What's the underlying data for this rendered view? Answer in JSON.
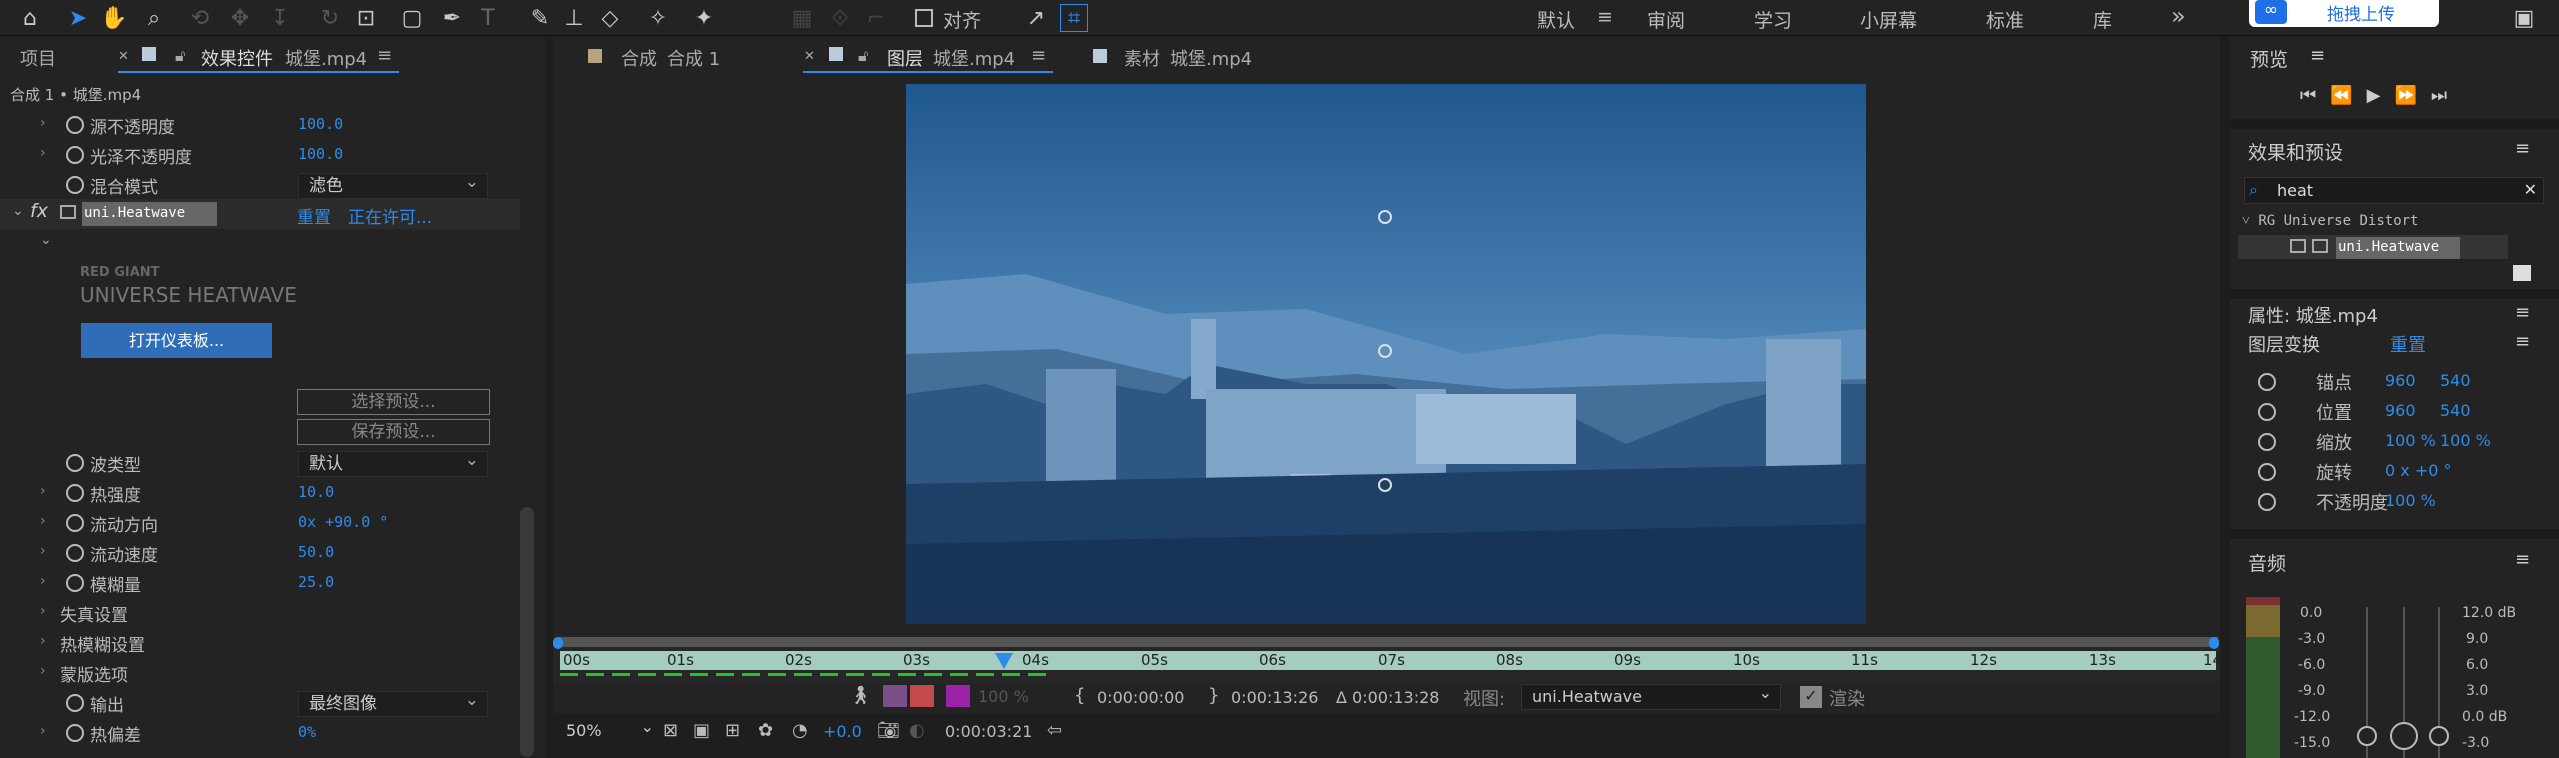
{
  "toolbar": {
    "align_label": "对齐",
    "workspaces": [
      "默认",
      "审阅",
      "学习",
      "小屏幕",
      "标准",
      "库"
    ],
    "upload_label": "拖拽上传",
    "more": "»",
    "menu_icon": "≡"
  },
  "left_panel": {
    "tabs": [
      "项目",
      "效果控件"
    ],
    "effect_file": "城堡.mp4",
    "breadcrumb": "合成 1 • 城堡.mp4",
    "rows_top": [
      {
        "label": "源不透明度",
        "value": "100.0"
      },
      {
        "label": "光泽不透明度",
        "value": "100.0"
      },
      {
        "label": "混合模式",
        "value": "滤色"
      }
    ],
    "fx_label": "fx",
    "effect_name": "uni.Heatwave",
    "reset": "重置",
    "licensing": "正在许可...",
    "brand_top": "RED GIANT",
    "brand_bottom": "UNIVERSE HEATWAVE",
    "open_dashboard": "打开仪表板...",
    "select_preset": "选择预设...",
    "save_preset": "保存预设...",
    "rows_bottom": [
      {
        "label": "波类型",
        "value": "默认",
        "dropdown": true
      },
      {
        "label": "热强度",
        "value": "10.0"
      },
      {
        "label": "流动方向",
        "value": "0x +90.0 °"
      },
      {
        "label": "流动速度",
        "value": "50.0"
      },
      {
        "label": "模糊量",
        "value": "25.0"
      }
    ],
    "groups": [
      "失真设置",
      "热模糊设置",
      "蒙版选项"
    ],
    "rows_end": [
      {
        "label": "输出",
        "value": "最终图像",
        "dropdown": true
      },
      {
        "label": "热偏差",
        "value": "0%"
      }
    ]
  },
  "viewer": {
    "tabs": [
      {
        "prefix": "合成",
        "name": "合成 1"
      },
      {
        "prefix": "图层",
        "name": "城堡.mp4"
      },
      {
        "prefix": "素材",
        "name": "城堡.mp4"
      }
    ],
    "time_ticks": [
      "00s",
      "01s",
      "02s",
      "03s",
      "04s",
      "05s",
      "06s",
      "07s",
      "08s",
      "09s",
      "10s",
      "11s",
      "12s",
      "13s",
      "14"
    ],
    "zoom": "100 %",
    "in_time": "0:00:00:00",
    "out_time": "0:00:13:26",
    "duration": "Δ 0:00:13:28",
    "view_label": "视图:",
    "view_value": "uni.Heatwave",
    "render_label": "渲染",
    "mag": "50%",
    "exposure": "+0.0",
    "current_time": "0:00:03:21"
  },
  "right_panel": {
    "preview_title": "预览",
    "effects_title": "效果和预设",
    "search_value": "heat",
    "tree_group": "RG Universe Distort",
    "tree_item": "uni.Heatwave",
    "props_title": "属性: 城堡.mp4",
    "transform_label": "图层变换",
    "transform_reset": "重置",
    "props": [
      {
        "label": "锚点",
        "v1": "960",
        "v2": "540"
      },
      {
        "label": "位置",
        "v1": "960",
        "v2": "540"
      },
      {
        "label": "缩放",
        "v1": "100 %",
        "v2": "100 %"
      },
      {
        "label": "旋转",
        "v1": "0 x +0 °",
        "v2": ""
      },
      {
        "label": "不透明度",
        "v1": "100 %",
        "v2": ""
      }
    ],
    "audio_title": "音频",
    "meter_left": [
      "0.0",
      "-3.0",
      "-6.0",
      "-9.0",
      "-12.0",
      "-15.0"
    ],
    "meter_right": [
      "12.0 dB",
      "9.0",
      "6.0",
      "3.0",
      "0.0 dB",
      "-3.0"
    ]
  }
}
